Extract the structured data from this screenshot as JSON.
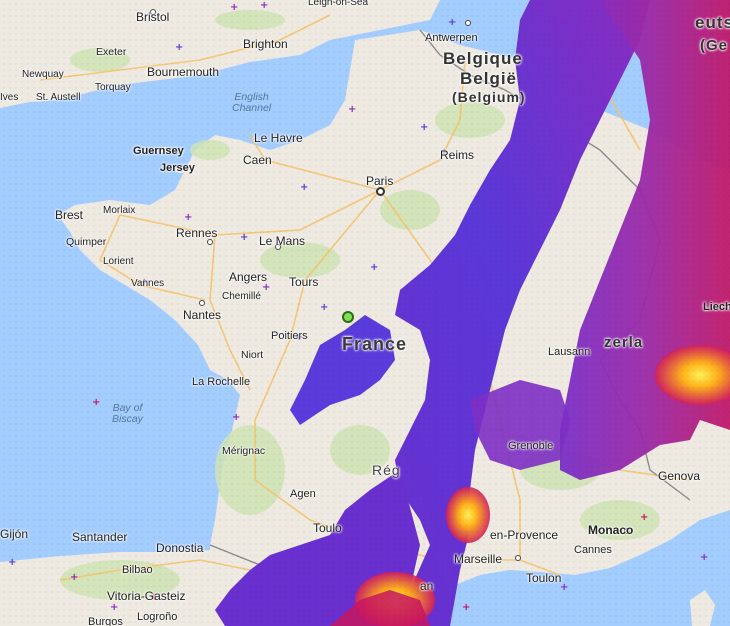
{
  "map": {
    "colors": {
      "sea": "#a3ccff",
      "land": "#eeeae2",
      "forest": "#cfe3b4",
      "roads": "#f5c36a",
      "borders": "#8a8a8a",
      "strike_old": "#5b3bd6",
      "strike_mid": "#8a2bbf",
      "strike_recent": "#c8155f",
      "strike_new": "#ff9a1a",
      "strike_newest": "#ffe24a"
    },
    "water_labels": {
      "english_channel": "English\nChannel",
      "bay_of_biscay": "Bay of\nBiscay"
    },
    "countries": {
      "belgium_fr": "Belgique",
      "belgium_nl": "België",
      "belgium_en": "(Belgium)",
      "france": "France",
      "germany_partial_1": "euts",
      "germany_partial_2": "(Ge",
      "switzerland_partial": "zerla"
    },
    "cities": {
      "bristol": "Bristol",
      "brighton": "Brighton",
      "exeter": "Exeter",
      "bournemouth": "Bournemouth",
      "newquay": "Newquay",
      "torquay": "Torquay",
      "ives": "Ives",
      "st_austell": "St. Austell",
      "leigh_on_sea": "Leigh-on-Sea",
      "antwerpen": "Antwerpen",
      "guernsey": "Guernsey",
      "jersey": "Jersey",
      "le_havre": "Le Havre",
      "caen": "Caen",
      "reims": "Reims",
      "paris": "Paris",
      "brest": "Brest",
      "morlaix": "Morlaix",
      "rennes": "Rennes",
      "quimper": "Quimper",
      "lorient": "Lorient",
      "vannes": "Vannes",
      "le_mans": "Le Mans",
      "angers": "Angers",
      "tours": "Tours",
      "cholet": "Chemillé",
      "nantes": "Nantes",
      "poitiers": "Poitiers",
      "niort": "Niort",
      "la_rochelle": "La Rochelle",
      "merignac": "Mérignac",
      "agen": "Agen",
      "toulouse": "Toulo",
      "lausanne": "Lausann",
      "liechtenstein": "Liech",
      "grenoble": "Grenoble",
      "genova": "Genova",
      "monaco": "Monaco",
      "cannes": "Cannes",
      "aix": "en-Provence",
      "marseille": "Marseille",
      "toulon": "Toulon",
      "gijon": "Gijón",
      "santander": "Santander",
      "donostia": "Donostia",
      "bilbao": "Bilbao",
      "vitoria": "Vitoria-Gasteiz",
      "logrono": "Logroño",
      "burgos": "Burgos",
      "regions_partial": "Rég",
      "an": "an"
    }
  }
}
